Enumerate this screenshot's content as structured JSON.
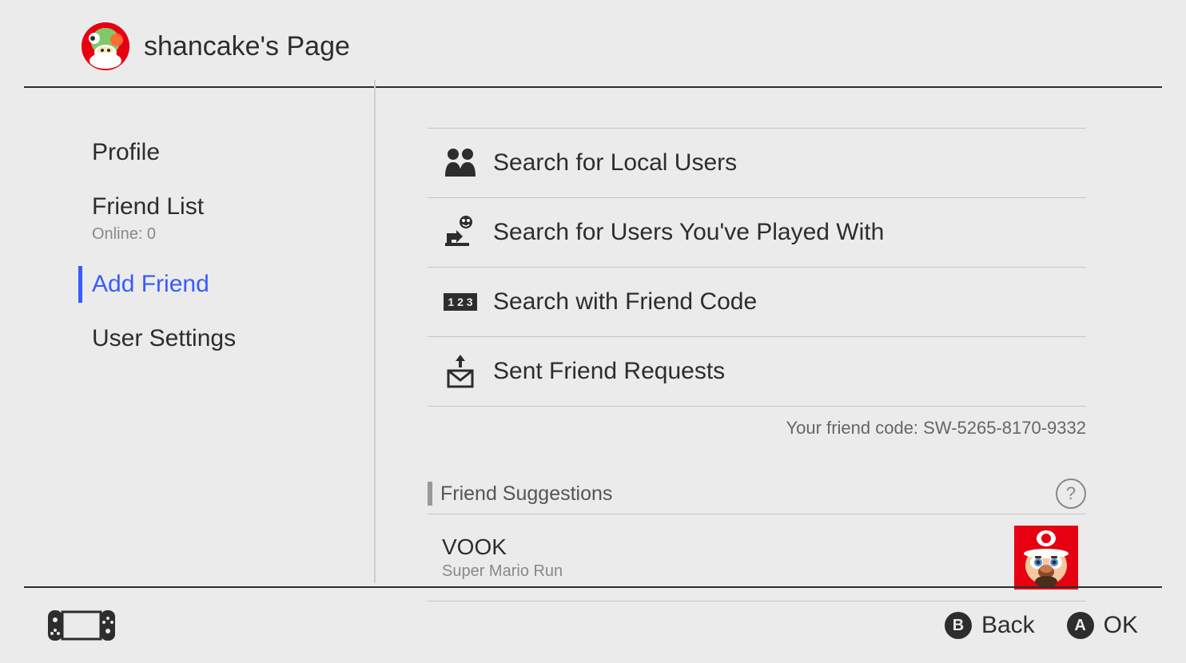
{
  "header": {
    "title": "shancake's Page"
  },
  "sidebar": {
    "items": [
      {
        "label": "Profile"
      },
      {
        "label": "Friend List",
        "sub": "Online: 0"
      },
      {
        "label": "Add Friend",
        "active": true
      },
      {
        "label": "User Settings"
      }
    ]
  },
  "main": {
    "actions": [
      {
        "label": "Search for Local Users",
        "icon": "local-users"
      },
      {
        "label": "Search for Users You've Played With",
        "icon": "played-with"
      },
      {
        "label": "Search with Friend Code",
        "icon": "friend-code"
      },
      {
        "label": "Sent Friend Requests",
        "icon": "sent-requests"
      }
    ],
    "friend_code_prefix": "Your friend code: ",
    "friend_code": "SW-5265-8170-9332",
    "suggestions_title": "Friend Suggestions",
    "suggestions": [
      {
        "name": "VOOK",
        "sub": "Super Mario Run"
      }
    ]
  },
  "footer": {
    "buttons": [
      {
        "key": "B",
        "label": "Back"
      },
      {
        "key": "A",
        "label": "OK"
      }
    ]
  }
}
